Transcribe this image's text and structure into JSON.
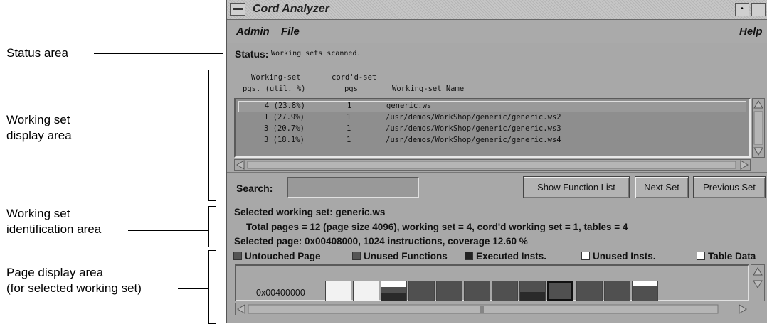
{
  "callouts": {
    "status_area": "Status area",
    "working_set_display_1": "Working set",
    "working_set_display_2": "display area",
    "working_set_ident_1": "Working set",
    "working_set_ident_2": "identification area",
    "page_display_1": "Page display area",
    "page_display_2": "(for selected working set)"
  },
  "window": {
    "title": "Cord Analyzer",
    "menus": [
      "Admin",
      "File",
      "Help"
    ]
  },
  "status": {
    "label": "Status:",
    "text": "Working sets scanned."
  },
  "columns": {
    "h1a": "Working-set",
    "h1b": "pgs. (util. %)",
    "h2a": "cord'd-set",
    "h2b": "pgs",
    "h3": "Working-set Name"
  },
  "working_sets": [
    {
      "pgs": "4 (23.8%)",
      "cord": "1",
      "name": "generic.ws"
    },
    {
      "pgs": "1 (27.9%)",
      "cord": "1",
      "name": "/usr/demos/WorkShop/generic/generic.ws2"
    },
    {
      "pgs": "3 (20.7%)",
      "cord": "1",
      "name": "/usr/demos/WorkShop/generic/generic.ws3"
    },
    {
      "pgs": "3 (18.1%)",
      "cord": "1",
      "name": "/usr/demos/WorkShop/generic/generic.ws4"
    }
  ],
  "search": {
    "label": "Search:",
    "value": ""
  },
  "buttons": {
    "show_function_list": "Show Function List",
    "next_set": "Next Set",
    "previous_set": "Previous Set"
  },
  "identification": {
    "selected_set": "Selected working set: generic.ws",
    "totals": "Total pages = 12 (page size 4096), working set = 4, cord'd working set = 1, tables = 4",
    "selected_page": "Selected page: 0x00408000,  1024 instructions, coverage 12.60 %"
  },
  "legend": {
    "untouched": "Untouched Page",
    "unused_functions": "Unused Functions",
    "executed": "Executed Insts.",
    "unused_insts": "Unused Insts.",
    "table_data": "Table Data"
  },
  "colors": {
    "window_bg": "#a8a8a8",
    "list_bg": "#8e8e8e",
    "untouched": "#f2f2f2",
    "unused_functions": "#505050",
    "executed": "#2a2a2a",
    "unused_insts": "#ffffff",
    "table_data": "#ffffff"
  },
  "page_display": {
    "address": "0x00400000",
    "pages": [
      "untouched",
      "untouched",
      "executed_top_white",
      "unused_functions",
      "unused_functions",
      "unused_functions",
      "unused_functions",
      "executed_bottom",
      "selected",
      "unused_functions",
      "unused_functions",
      "table_top"
    ]
  }
}
